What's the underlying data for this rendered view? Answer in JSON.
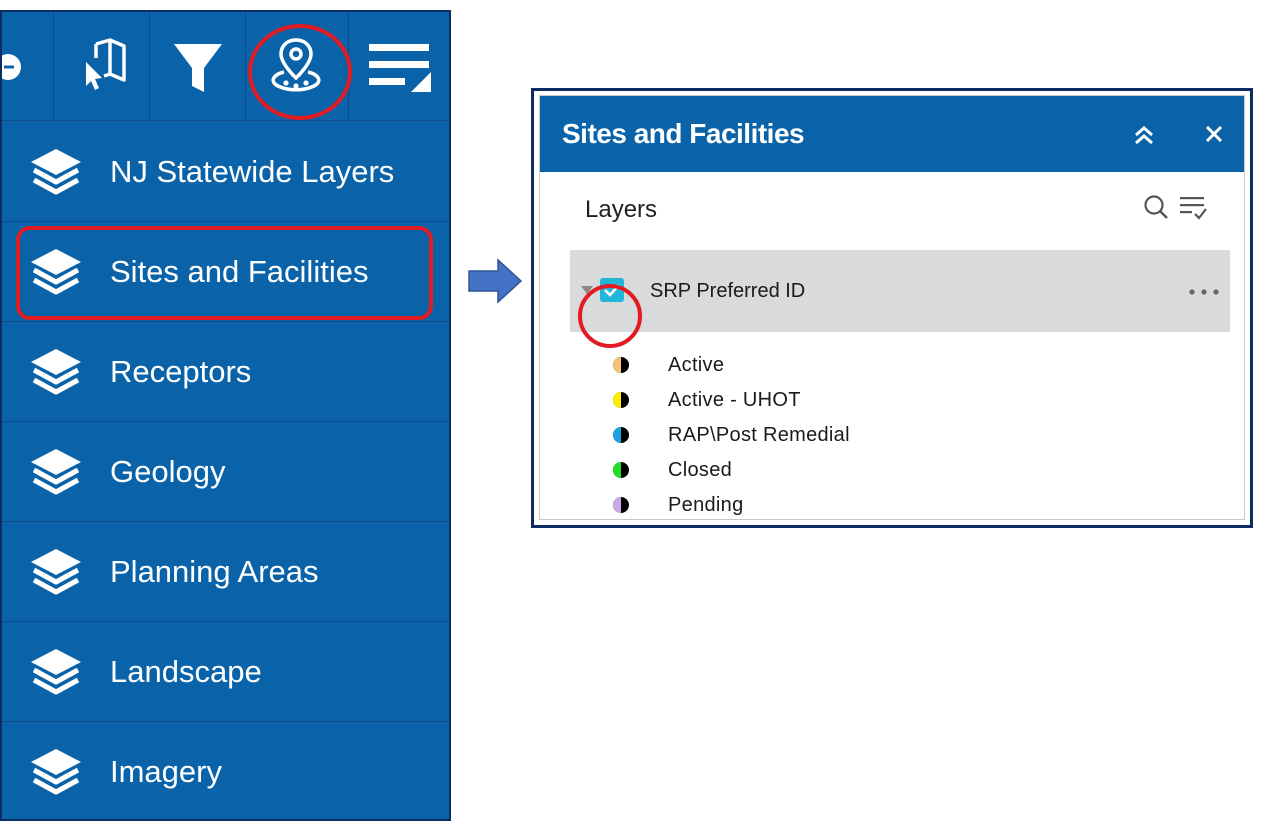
{
  "sidebar": {
    "toolbar": [
      {
        "icon": "partial-circle-icon"
      },
      {
        "icon": "select-map-icon"
      },
      {
        "icon": "filter-icon"
      },
      {
        "icon": "location-pin-icon"
      },
      {
        "icon": "layer-list-icon"
      }
    ],
    "items": [
      {
        "label": "NJ Statewide Layers",
        "icon": "layers-icon"
      },
      {
        "label": "Sites and Facilities",
        "icon": "layers-icon"
      },
      {
        "label": "Receptors",
        "icon": "layers-icon"
      },
      {
        "label": "Geology",
        "icon": "layers-icon"
      },
      {
        "label": "Planning Areas",
        "icon": "layers-icon"
      },
      {
        "label": "Landscape",
        "icon": "layers-icon"
      },
      {
        "label": "Imagery",
        "icon": "layers-icon"
      }
    ]
  },
  "panel": {
    "title": "Sites and Facilities",
    "layers_label": "Layers",
    "layer": {
      "name": "SRP Preferred ID",
      "checked": true
    },
    "legend": [
      {
        "label": "Active",
        "color": "#f5c27a"
      },
      {
        "label": "Active - UHOT",
        "color": "#ffee00"
      },
      {
        "label": "RAP\\Post Remedial",
        "color": "#1fa3e0"
      },
      {
        "label": "Closed",
        "color": "#22dd22"
      },
      {
        "label": "Pending",
        "color": "#c8a8e8"
      }
    ]
  },
  "colors": {
    "brand_blue": "#0a63a8",
    "highlight_red": "#e31b23",
    "checkbox_cyan": "#1fb6d7",
    "arrow_blue": "#4472c4"
  }
}
